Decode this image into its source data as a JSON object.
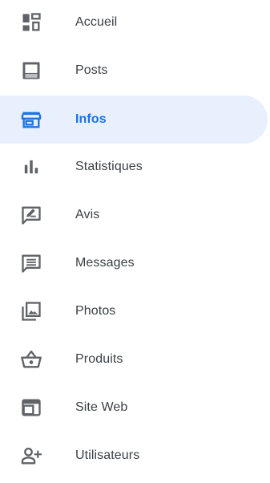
{
  "colors": {
    "icon_default": "#5f6368",
    "text_default": "#3c4043",
    "accent": "#1a73e8",
    "active_background": "#e8f0fe"
  },
  "nav": {
    "items": [
      {
        "label": "Accueil",
        "icon": "dashboard-icon",
        "active": false
      },
      {
        "label": "Posts",
        "icon": "post-icon",
        "active": false
      },
      {
        "label": "Infos",
        "icon": "storefront-icon",
        "active": true
      },
      {
        "label": "Statistiques",
        "icon": "bar-chart-icon",
        "active": false
      },
      {
        "label": "Avis",
        "icon": "rate-review-icon",
        "active": false
      },
      {
        "label": "Messages",
        "icon": "chat-icon",
        "active": false
      },
      {
        "label": "Photos",
        "icon": "photo-library-icon",
        "active": false
      },
      {
        "label": "Produits",
        "icon": "shopping-basket-icon",
        "active": false
      },
      {
        "label": "Site Web",
        "icon": "website-icon",
        "active": false
      },
      {
        "label": "Utilisateurs",
        "icon": "add-user-icon",
        "active": false
      }
    ]
  }
}
